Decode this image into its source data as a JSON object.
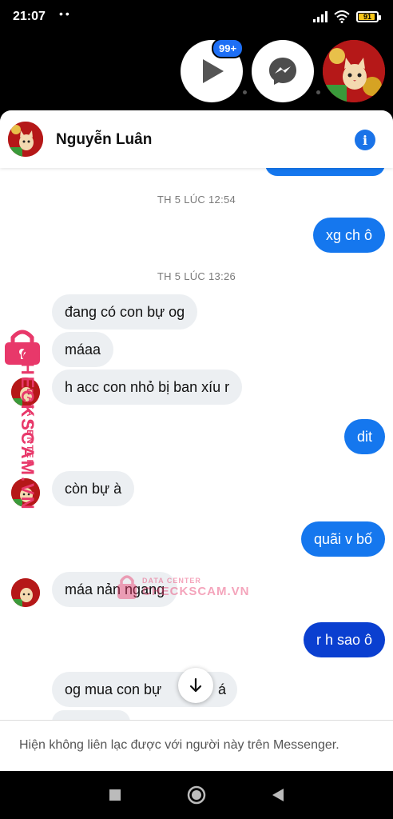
{
  "status_bar": {
    "time": "21:07",
    "dots": "••",
    "battery": "91",
    "icons": [
      "signal-icon",
      "wifi-icon",
      "battery-icon"
    ]
  },
  "chat_heads": {
    "badge": "99+",
    "items": [
      "video-play-icon",
      "messenger-icon",
      "contact-avatar"
    ]
  },
  "header": {
    "name": "Nguyễn Luân",
    "info_icon": "info-icon"
  },
  "messages": {
    "timestamp_1": "TH 5 LÚC 12:54",
    "timestamp_2": "TH 5 LÚC 13:26",
    "m1": "xg ch ô",
    "m2": "đang có con bự og",
    "m3": "máaa",
    "m4": "h acc con nhỏ bị ban xíu r",
    "m5": "dit",
    "m6": "còn bự à",
    "m7": "quãi v bố",
    "m8": "máa nản ngang",
    "m9": "r h sao ô",
    "m10": "og mua con bự",
    "m10_tail": "á"
  },
  "footer": {
    "text": "Hiện không liên lạc được với người này trên Messenger."
  },
  "watermark": {
    "top_line": "DATA CENTER",
    "brand": "CHECKSCAM.VN"
  },
  "nav": [
    "recents-square-icon",
    "home-circle-icon",
    "back-triangle-icon"
  ],
  "colors": {
    "outgoing": "#1577ee",
    "outgoing_dark": "#0a3fd0",
    "incoming": "#eceff2",
    "info": "#1a73e8",
    "badge": "#1e6ff5",
    "watermark": "#e8386a"
  }
}
